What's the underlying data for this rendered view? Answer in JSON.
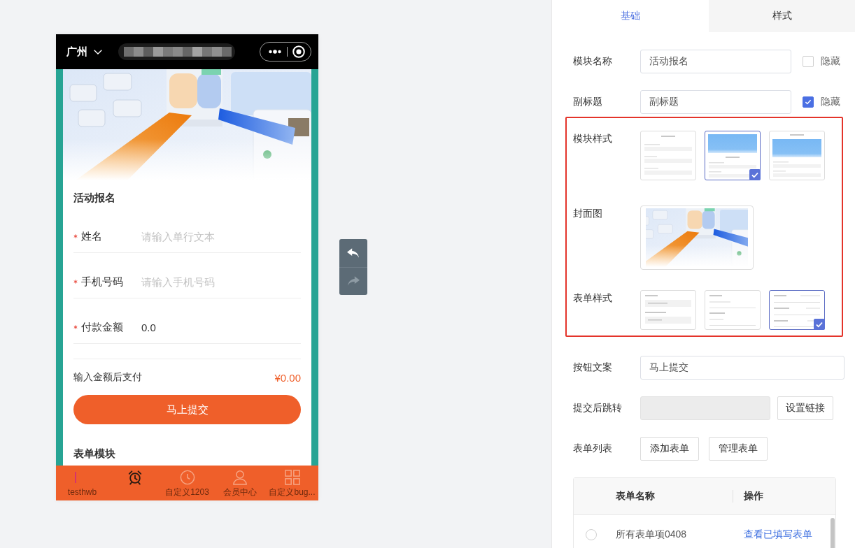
{
  "phone_preview": {
    "nav_bar": {
      "city": "广州"
    },
    "module_title": "活动报名",
    "fields": [
      {
        "label": "姓名",
        "required": true,
        "placeholder": "请输入单行文本"
      },
      {
        "label": "手机号码",
        "required": true,
        "placeholder": "请输入手机号码"
      },
      {
        "label": "付款金额",
        "required": true,
        "value": "0.0"
      }
    ],
    "payment": {
      "label": "输入金额后支付",
      "amount": "¥0.00"
    },
    "submit_button": "马上提交",
    "next_module_title": "表单模块",
    "tab_bar": [
      {
        "label": "testhwb",
        "selected": false
      },
      {
        "selected": true
      },
      {
        "label": "自定义1203",
        "selected": false
      },
      {
        "label": "会员中心",
        "selected": false
      },
      {
        "label": "自定义bug...",
        "selected": false
      }
    ]
  },
  "history_controls": [
    {
      "kind": "undo",
      "disabled": false
    },
    {
      "kind": "redo",
      "disabled": true
    }
  ],
  "settings_panel": {
    "tabs": [
      {
        "label": "基础",
        "selected": true
      },
      {
        "label": "样式",
        "selected": false
      }
    ],
    "module_name": {
      "label": "模块名称",
      "value": "活动报名",
      "hide": {
        "label": "隐藏",
        "checked": false
      }
    },
    "subtitle": {
      "label": "副标题",
      "value": "副标题",
      "hide": {
        "label": "隐藏",
        "checked": true
      }
    },
    "style_section": {
      "highlighted": true,
      "module_style": {
        "label": "模块样式",
        "options": [
          {
            "kind": "plain",
            "selected": false
          },
          {
            "kind": "banner",
            "selected": true
          },
          {
            "kind": "inset-banner",
            "selected": false
          }
        ]
      },
      "cover_image": {
        "label": "封面图"
      },
      "form_style": {
        "label": "表单样式",
        "options": [
          {
            "kind": "boxed",
            "selected": false
          },
          {
            "kind": "underlined",
            "selected": false
          },
          {
            "kind": "inline",
            "selected": true
          }
        ]
      }
    },
    "button_text": {
      "label": "按钮文案",
      "value": "马上提交"
    },
    "redirect": {
      "label": "提交后跳转",
      "disabled": true,
      "button": "设置链接"
    },
    "form_list": {
      "label": "表单列表",
      "buttons": [
        "添加表单",
        "管理表单"
      ],
      "table": {
        "columns": [
          "表单名称",
          "操作"
        ],
        "rows": [
          {
            "selected": false,
            "name": "所有表单项0408",
            "action": "查看已填写表单"
          }
        ]
      }
    }
  }
}
